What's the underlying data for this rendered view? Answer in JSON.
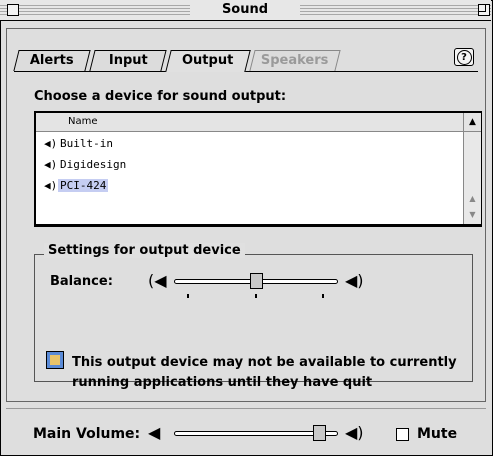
{
  "window": {
    "title": "Sound"
  },
  "tabs": [
    {
      "label": "Alerts",
      "state": "normal"
    },
    {
      "label": "Input",
      "state": "normal"
    },
    {
      "label": "Output",
      "state": "active"
    },
    {
      "label": "Speakers",
      "state": "disabled"
    }
  ],
  "help_label": "?",
  "device_list": {
    "heading": "Choose a device for sound output:",
    "column_header": "Name",
    "devices": [
      {
        "name": "Built-in",
        "selected": false
      },
      {
        "name": "Digidesign",
        "selected": false
      },
      {
        "name": "PCI-424",
        "selected": true
      }
    ]
  },
  "settings": {
    "group_label": "Settings for output device",
    "balance_label": "Balance:",
    "balance_value": 0.5
  },
  "warning": {
    "icon": "control-panel-icon",
    "text_line1": "This output device may not be available to currently",
    "text_line2": "running applications until they have quit"
  },
  "volume": {
    "label": "Main Volume:",
    "value": 1.0,
    "mute_label": "Mute",
    "muted": false
  },
  "colors": {
    "selection": "#c5cdf2",
    "window_bg": "#dedede",
    "disabled_text": "#9a9a9a"
  }
}
